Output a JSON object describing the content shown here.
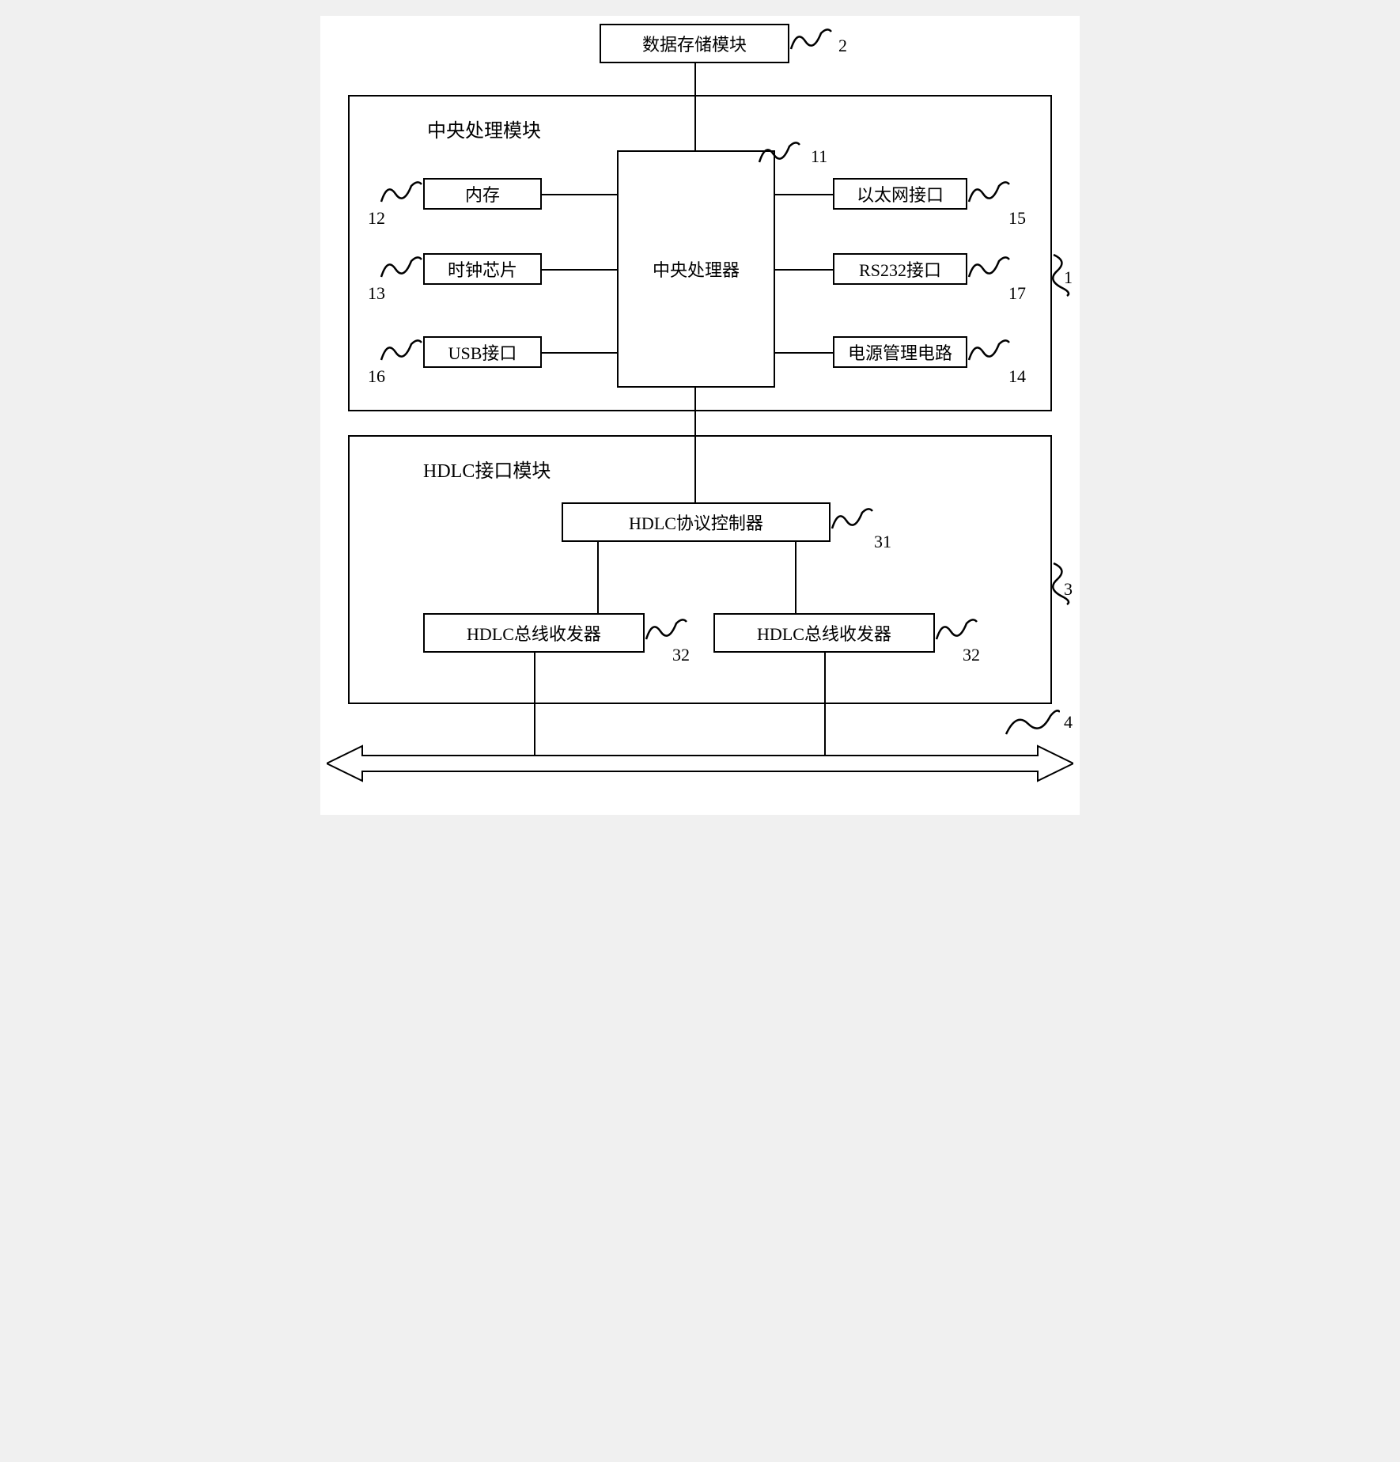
{
  "top": {
    "storage": "数据存储模块",
    "ref2": "2"
  },
  "cpu_module": {
    "title": "中央处理模块",
    "cpu": "中央处理器",
    "ref11": "11",
    "memory": "内存",
    "ref12": "12",
    "clock": "时钟芯片",
    "ref13": "13",
    "usb": "USB接口",
    "ref16": "16",
    "ethernet": "以太网接口",
    "ref15": "15",
    "rs232": "RS232接口",
    "ref17": "17",
    "power": "电源管理电路",
    "ref14": "14",
    "ref1": "1"
  },
  "hdlc_module": {
    "title": "HDLC接口模块",
    "controller": "HDLC协议控制器",
    "ref31": "31",
    "transceiver1": "HDLC总线收发器",
    "transceiver2": "HDLC总线收发器",
    "ref32a": "32",
    "ref32b": "32",
    "ref3": "3"
  },
  "bus": {
    "ref4": "4"
  }
}
